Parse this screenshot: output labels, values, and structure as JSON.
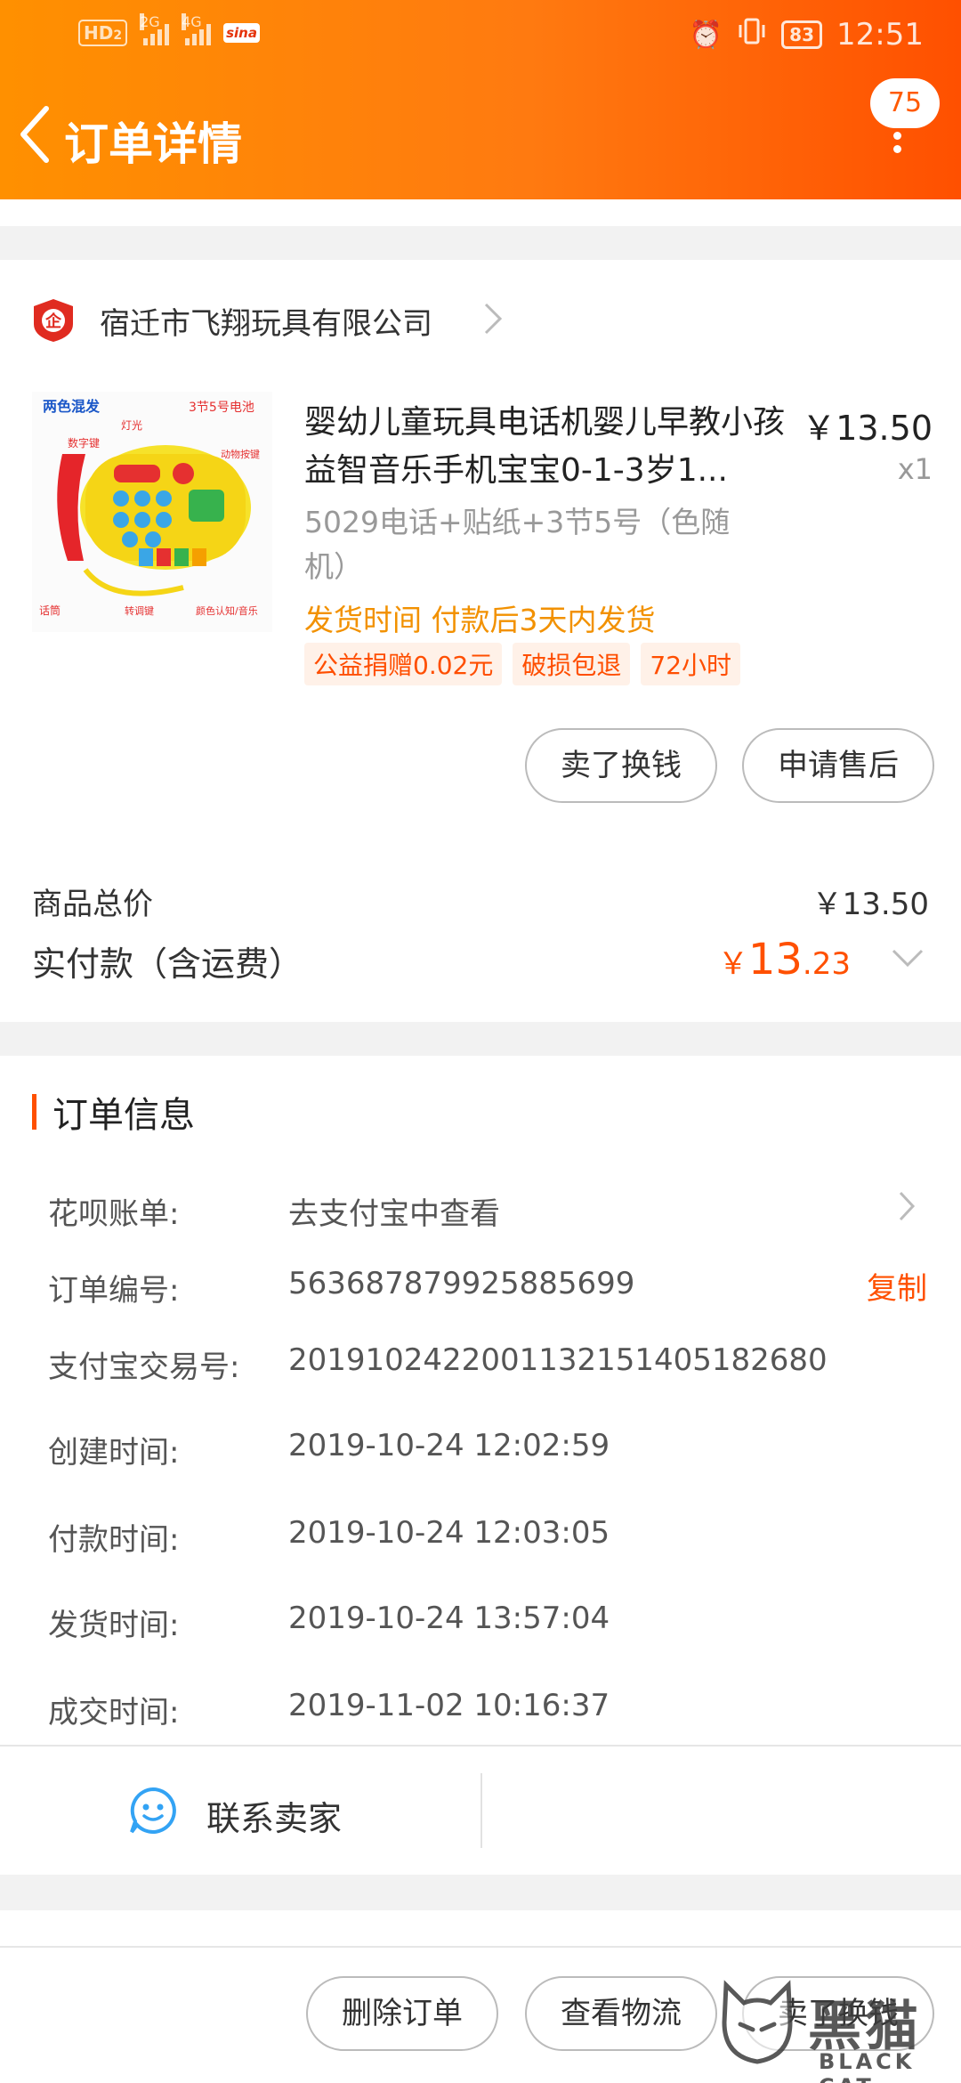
{
  "status_bar": {
    "hd": "HD",
    "hd_sub": "2",
    "net1": "2G",
    "net2": "4G",
    "app_badge": "sina",
    "battery": "83",
    "time": "12:51"
  },
  "header": {
    "title": "订单详情",
    "message_count": "75"
  },
  "shop": {
    "name": "宿迁市飞翔玩具有限公司"
  },
  "product": {
    "title": "婴幼儿童玩具电话机婴儿早教小孩益智音乐手机宝宝0-1-3岁1...",
    "price": "￥13.50",
    "qty": "x1",
    "sku": "5029电话+贴纸+3节5号（色随机）",
    "shipping": "发货时间 付款后3天内发货",
    "tags": [
      "公益捐赠0.02元",
      "破损包退",
      "72小时"
    ],
    "image_labels": [
      "两色混发",
      "3节5号电池",
      "灯光",
      "数字键",
      "动物按键",
      "话筒",
      "转调键",
      "颜色认知/音乐"
    ]
  },
  "item_actions": {
    "sell": "卖了换钱",
    "after_sale": "申请售后"
  },
  "totals": {
    "goods_label": "商品总价",
    "goods_value": "￥13.50",
    "paid_label": "实付款（含运费）",
    "paid_currency": "￥",
    "paid_int": "13",
    "paid_dec": ".23"
  },
  "order_info": {
    "title": "订单信息",
    "huabei_label": "花呗账单:",
    "huabei_value": "去支付宝中查看",
    "order_no_label": "订单编号:",
    "order_no": "563687879925885699",
    "copy": "复制",
    "alipay_label": "支付宝交易号:",
    "alipay_no": "2019102422001132151405182680",
    "created_label": "创建时间:",
    "created": "2019-10-24 12:02:59",
    "paid_label": "付款时间:",
    "paid": "2019-10-24 12:03:05",
    "shipped_label": "发货时间:",
    "shipped": "2019-10-24 13:57:04",
    "closed_label": "成交时间:",
    "closed": "2019-11-02 10:16:37"
  },
  "contact": {
    "label": "联系卖家"
  },
  "bottom_actions": {
    "delete": "删除订单",
    "logistics": "查看物流",
    "sell": "卖了换钱"
  },
  "watermark": {
    "cn": "黑猫",
    "en": "BLACK CAT"
  },
  "colors": {
    "brand_orange": "#ff5000",
    "header_start": "#ff9000",
    "ship_text": "#f29100"
  }
}
